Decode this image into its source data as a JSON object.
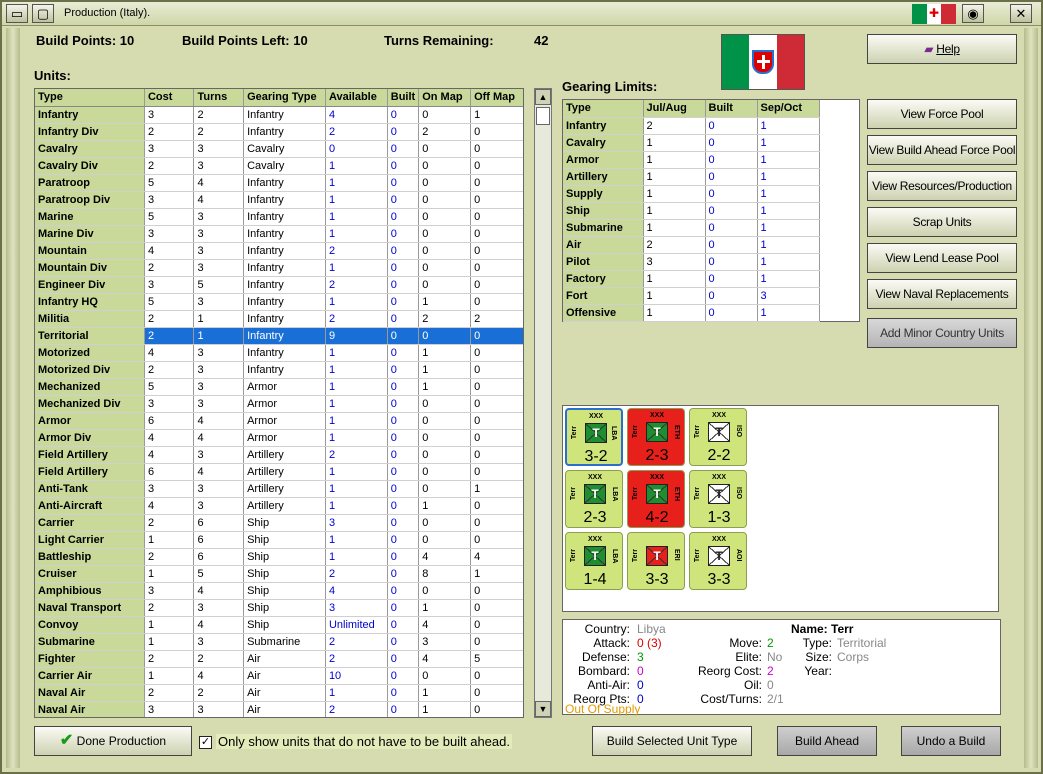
{
  "window": {
    "title": "Production (Italy)."
  },
  "header": {
    "build_points": "Build Points: 10",
    "build_points_left": "Build Points Left: 10",
    "turns_label": "Turns Remaining:",
    "turns_value": "42"
  },
  "labels": {
    "units": "Units:",
    "gearing": "Gearing Limits:"
  },
  "colors": {
    "flag_green": "#009246",
    "flag_white": "#ffffff",
    "flag_red": "#ce2b37",
    "selected_row": "#1a6fd6",
    "counter_green": "#cfe57b",
    "counter_red": "#e8201c"
  },
  "units_table": {
    "headers": [
      "Type",
      "Cost",
      "Turns",
      "Gearing Type",
      "Available",
      "Built",
      "On Map",
      "Off Map"
    ],
    "rows": [
      [
        "Infantry",
        "3",
        "2",
        "Infantry",
        "4",
        "0",
        "0",
        "1"
      ],
      [
        "Infantry Div",
        "2",
        "2",
        "Infantry",
        "2",
        "0",
        "2",
        "0"
      ],
      [
        "Cavalry",
        "3",
        "3",
        "Cavalry",
        "0",
        "0",
        "0",
        "0"
      ],
      [
        "Cavalry Div",
        "2",
        "3",
        "Cavalry",
        "1",
        "0",
        "0",
        "0"
      ],
      [
        "Paratroop",
        "5",
        "4",
        "Infantry",
        "1",
        "0",
        "0",
        "0"
      ],
      [
        "Paratroop Div",
        "3",
        "4",
        "Infantry",
        "1",
        "0",
        "0",
        "0"
      ],
      [
        "Marine",
        "5",
        "3",
        "Infantry",
        "1",
        "0",
        "0",
        "0"
      ],
      [
        "Marine Div",
        "3",
        "3",
        "Infantry",
        "1",
        "0",
        "0",
        "0"
      ],
      [
        "Mountain",
        "4",
        "3",
        "Infantry",
        "2",
        "0",
        "0",
        "0"
      ],
      [
        "Mountain Div",
        "2",
        "3",
        "Infantry",
        "1",
        "0",
        "0",
        "0"
      ],
      [
        "Engineer Div",
        "3",
        "5",
        "Infantry",
        "2",
        "0",
        "0",
        "0"
      ],
      [
        "Infantry HQ",
        "5",
        "3",
        "Infantry",
        "1",
        "0",
        "1",
        "0"
      ],
      [
        "Militia",
        "2",
        "1",
        "Infantry",
        "2",
        "0",
        "2",
        "2"
      ],
      [
        "Territorial",
        "2",
        "1",
        "Infantry",
        "9",
        "0",
        "0",
        "0"
      ],
      [
        "Motorized",
        "4",
        "3",
        "Infantry",
        "1",
        "0",
        "1",
        "0"
      ],
      [
        "Motorized Div",
        "2",
        "3",
        "Infantry",
        "1",
        "0",
        "1",
        "0"
      ],
      [
        "Mechanized",
        "5",
        "3",
        "Armor",
        "1",
        "0",
        "1",
        "0"
      ],
      [
        "Mechanized Div",
        "3",
        "3",
        "Armor",
        "1",
        "0",
        "0",
        "0"
      ],
      [
        "Armor",
        "6",
        "4",
        "Armor",
        "1",
        "0",
        "0",
        "0"
      ],
      [
        "Armor Div",
        "4",
        "4",
        "Armor",
        "1",
        "0",
        "0",
        "0"
      ],
      [
        "Field Artillery",
        "4",
        "3",
        "Artillery",
        "2",
        "0",
        "0",
        "0"
      ],
      [
        "Field Artillery",
        "6",
        "4",
        "Artillery",
        "1",
        "0",
        "0",
        "0"
      ],
      [
        "Anti-Tank",
        "3",
        "3",
        "Artillery",
        "1",
        "0",
        "0",
        "1"
      ],
      [
        "Anti-Aircraft",
        "4",
        "3",
        "Artillery",
        "1",
        "0",
        "1",
        "0"
      ],
      [
        "Carrier",
        "2",
        "6",
        "Ship",
        "3",
        "0",
        "0",
        "0"
      ],
      [
        "Light Carrier",
        "1",
        "6",
        "Ship",
        "1",
        "0",
        "0",
        "0"
      ],
      [
        "Battleship",
        "2",
        "6",
        "Ship",
        "1",
        "0",
        "4",
        "4"
      ],
      [
        "Cruiser",
        "1",
        "5",
        "Ship",
        "2",
        "0",
        "8",
        "1"
      ],
      [
        "Amphibious",
        "3",
        "4",
        "Ship",
        "4",
        "0",
        "0",
        "0"
      ],
      [
        "Naval Transport",
        "2",
        "3",
        "Ship",
        "3",
        "0",
        "1",
        "0"
      ],
      [
        "Convoy",
        "1",
        "4",
        "Ship",
        "Unlimited",
        "0",
        "4",
        "0"
      ],
      [
        "Submarine",
        "1",
        "3",
        "Submarine",
        "2",
        "0",
        "3",
        "0"
      ],
      [
        "Fighter",
        "2",
        "2",
        "Air",
        "2",
        "0",
        "4",
        "5"
      ],
      [
        "Carrier Air",
        "1",
        "4",
        "Air",
        "10",
        "0",
        "0",
        "0"
      ],
      [
        "Naval Air",
        "2",
        "2",
        "Air",
        "1",
        "0",
        "1",
        "0"
      ],
      [
        "Naval Air",
        "3",
        "3",
        "Air",
        "2",
        "0",
        "1",
        "0"
      ]
    ],
    "selected_index": 13
  },
  "gearing_table": {
    "headers": [
      "Type",
      "Jul/Aug",
      "Built",
      "Sep/Oct"
    ],
    "rows": [
      [
        "Infantry",
        "2",
        "0",
        "1"
      ],
      [
        "Cavalry",
        "1",
        "0",
        "1"
      ],
      [
        "Armor",
        "1",
        "0",
        "1"
      ],
      [
        "Artillery",
        "1",
        "0",
        "1"
      ],
      [
        "Supply",
        "1",
        "0",
        "1"
      ],
      [
        "Ship",
        "1",
        "0",
        "1"
      ],
      [
        "Submarine",
        "1",
        "0",
        "1"
      ],
      [
        "Air",
        "2",
        "0",
        "1"
      ],
      [
        "Pilot",
        "3",
        "0",
        "1"
      ],
      [
        "Factory",
        "1",
        "0",
        "1"
      ],
      [
        "Fort",
        "1",
        "0",
        "3"
      ],
      [
        "Offensive",
        "1",
        "0",
        "1"
      ]
    ]
  },
  "buttons": {
    "help": "Help",
    "side": [
      "View Force Pool",
      "View Build Ahead Force Pool",
      "View Resources/Production",
      "Scrap Units",
      "View Lend Lease Pool",
      "View Naval Replacements",
      "Add Minor Country Units"
    ],
    "done": "Done Production",
    "only_show": "Only show units that do not have to be built ahead.",
    "build_selected": "Build Selected Unit Type",
    "build_ahead": "Build Ahead",
    "undo": "Undo a Build"
  },
  "counters": [
    {
      "xxx": "XXX",
      "left": "Terr",
      "right": "LBA",
      "val": "3-2",
      "color": "green"
    },
    {
      "xxx": "XXX",
      "left": "Terr",
      "right": "ETH",
      "val": "2-3",
      "color": "red"
    },
    {
      "xxx": "XXX",
      "left": "Terr",
      "right": "ISO",
      "val": "2-2",
      "color": "green"
    },
    {
      "xxx": "XXX",
      "left": "Terr",
      "right": "LBA",
      "val": "2-3",
      "color": "green"
    },
    {
      "xxx": "XXX",
      "left": "Terr",
      "right": "ETH",
      "val": "4-2",
      "color": "red"
    },
    {
      "xxx": "XXX",
      "left": "Terr",
      "right": "ISO",
      "val": "1-3",
      "color": "green"
    },
    {
      "xxx": "XXX",
      "left": "Terr",
      "right": "LBA",
      "val": "1-4",
      "color": "green"
    },
    {
      "xxx": "",
      "left": "Terr",
      "right": "ERI",
      "val": "3-3",
      "color": "green"
    },
    {
      "xxx": "XXX",
      "left": "Terr",
      "right": "AOI",
      "val": "3-3",
      "color": "green"
    }
  ],
  "info": {
    "country_k": "Country:",
    "country_v": "Libya",
    "attack_k": "Attack:",
    "attack_v": "0 (3)",
    "defense_k": "Defense:",
    "defense_v": "3",
    "bombard_k": "Bombard:",
    "bombard_v": "0",
    "antiair_k": "Anti-Air:",
    "antiair_v": "0",
    "reorg_k": "Reorg Pts:",
    "reorg_v": "0",
    "supply": "Out Of Supply",
    "move_k": "Move:",
    "move_v": "2",
    "elite_k": "Elite:",
    "elite_v": "No",
    "reorgcost_k": "Reorg Cost:",
    "reorgcost_v": "2",
    "oil_k": "Oil:",
    "oil_v": "0",
    "costturns_k": "Cost/Turns:",
    "costturns_v": "2/1",
    "name": "Name: Terr",
    "type_k": "Type:",
    "type_v": "Territorial",
    "size_k": "Size:",
    "size_v": "Corps",
    "year_k": "Year:"
  }
}
